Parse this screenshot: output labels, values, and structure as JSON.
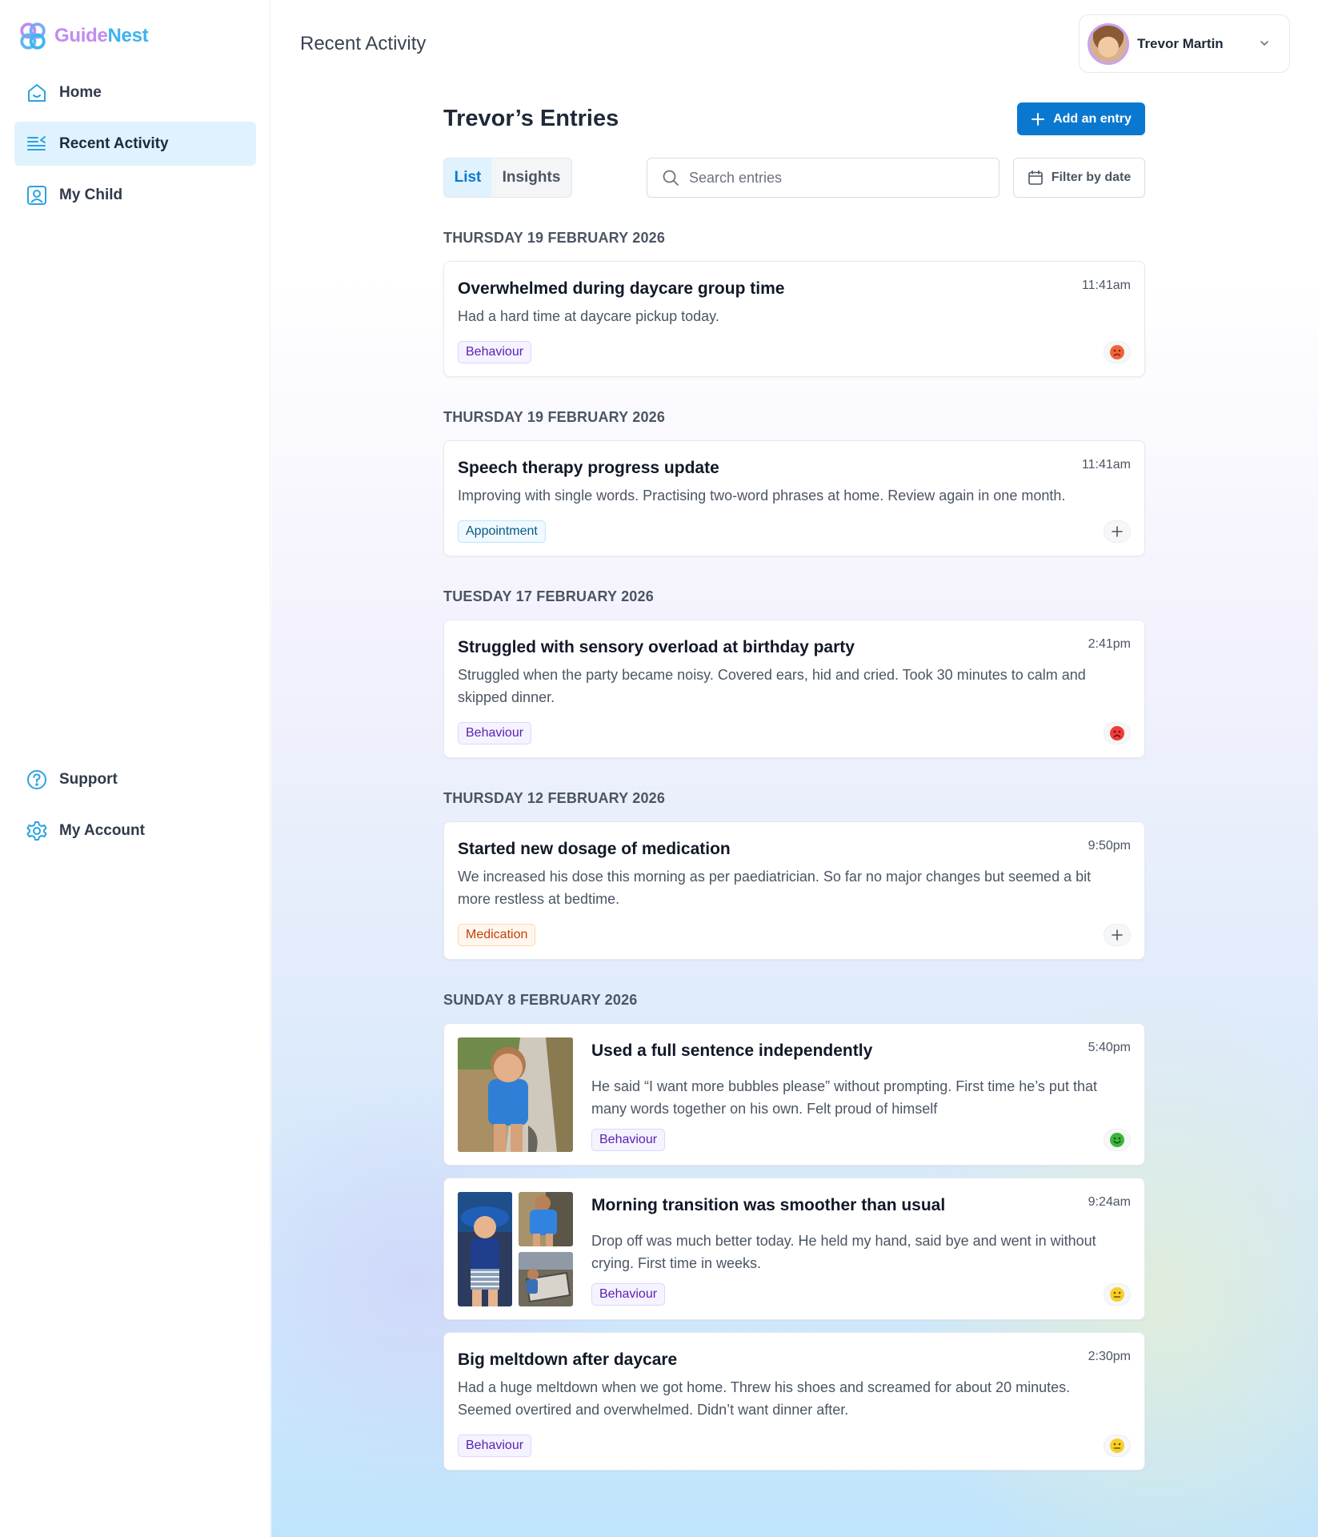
{
  "app": {
    "name_part1": "Guide",
    "name_part2": "Nest"
  },
  "sidebar": {
    "items": [
      {
        "label": "Home",
        "icon": "home-icon"
      },
      {
        "label": "Recent Activity",
        "icon": "list-icon",
        "active": true
      },
      {
        "label": "My Child",
        "icon": "child-profile-icon"
      }
    ],
    "bottom_items": [
      {
        "label": "Support",
        "icon": "help-icon"
      },
      {
        "label": "My Account",
        "icon": "gear-icon"
      }
    ]
  },
  "header": {
    "title": "Recent Activity",
    "user_name": "Trevor Martin"
  },
  "entries": {
    "title": "Trevor’s Entries",
    "add_label": "Add an entry",
    "tabs": [
      "List",
      "Insights"
    ],
    "search_placeholder": "Search entries",
    "filter_label": "Filter by date"
  },
  "days": [
    "THURSDAY 19 FEBRUARY 2026",
    "THURSDAY 19 FEBRUARY 2026",
    "TUESDAY 17 FEBRUARY 2026",
    "THURSDAY 12 FEBRUARY 2026",
    "SUNDAY 8 FEBRUARY 2026"
  ],
  "cards": [
    {
      "title": "Overwhelmed during daycare group time",
      "time": "11:41am",
      "text": "Had a hard time at daycare pickup today.",
      "tag": "Behaviour",
      "mood": "frown-face-icon"
    },
    {
      "title": "Speech therapy progress update",
      "time": "11:41am",
      "text": "Improving with single words. Practising two-word phrases at home. Review again in one month.",
      "tag": "Appointment",
      "mood": "plus-icon"
    },
    {
      "title": "Struggled with sensory overload at birthday party",
      "time": "2:41pm",
      "text": "Struggled when the party became noisy. Covered ears, hid and cried. Took 30 minutes to calm and skipped dinner.",
      "tag": "Behaviour",
      "mood": "sad-face-icon"
    },
    {
      "title": "Started new dosage of medication",
      "time": "9:50pm",
      "text": "We increased his dose this morning as per paediatrician. So far no major changes but seemed a bit more restless at bedtime.",
      "tag": "Medication",
      "mood": "plus-icon"
    },
    {
      "title": "Used a full sentence independently",
      "time": "5:40pm",
      "text": "He said “I want more bubbles please” without prompting. First time he’s put that many words together on his own. Felt proud of himself",
      "tag": "Behaviour",
      "mood": "happy-face-icon"
    },
    {
      "title": "Morning transition was smoother than usual",
      "time": "9:24am",
      "text": "Drop off was much better today. He held my hand, said bye and went in without crying. First time in weeks.",
      "tag": "Behaviour",
      "mood": "neutral-face-icon"
    },
    {
      "title": "Big meltdown after daycare",
      "time": "2:30pm",
      "text": "Had a huge meltdown when we got home. Threw his shoes and screamed for about 20 minutes. Seemed overtired and overwhelmed. Didn’t want dinner after.",
      "tag": "Behaviour",
      "mood": "neutral-face-icon"
    }
  ],
  "colors": {
    "accent": "#0b78d0",
    "nav_active_bg": "#e0f2fe",
    "behaviour_tag": "#5b21b6",
    "appointment_tag": "#075985",
    "medication_tag": "#c2410c"
  }
}
